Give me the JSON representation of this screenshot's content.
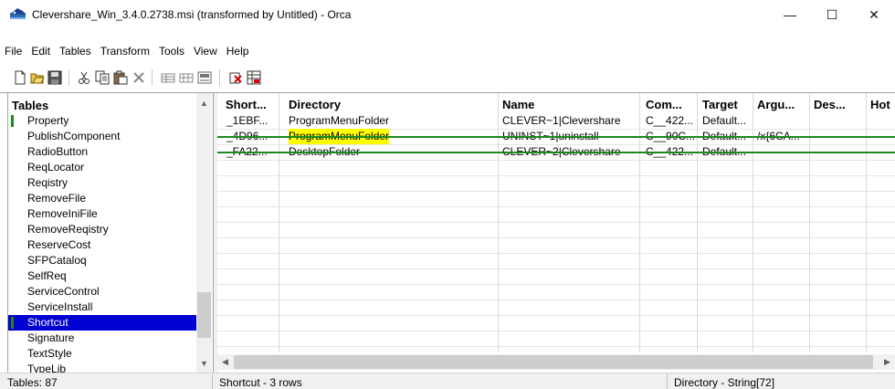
{
  "window": {
    "title": "Clevershare_Win_3.4.0.2738.msi (transformed by Untitled) - Orca",
    "minimize": "—",
    "maximize": "☐",
    "close": "✕"
  },
  "menu": [
    "File",
    "Edit",
    "Tables",
    "Transform",
    "Tools",
    "View",
    "Help"
  ],
  "toolbar_icons": [
    "new-icon",
    "open-icon",
    "save-icon",
    "cut-icon",
    "copy-icon",
    "paste-icon",
    "delete-icon",
    "add-row-icon",
    "add-table-icon",
    "drop-table-icon",
    "validate-icon",
    "merge-module-icon"
  ],
  "tables": {
    "header": "Tables",
    "items": [
      {
        "label": "Property",
        "marked": true,
        "selected": false
      },
      {
        "label": "PublishComponent",
        "marked": false,
        "selected": false
      },
      {
        "label": "RadioButton",
        "marked": false,
        "selected": false
      },
      {
        "label": "ReqLocator",
        "marked": false,
        "selected": false
      },
      {
        "label": "Reqistry",
        "marked": false,
        "selected": false
      },
      {
        "label": "RemoveFile",
        "marked": false,
        "selected": false
      },
      {
        "label": "RemoveIniFile",
        "marked": false,
        "selected": false
      },
      {
        "label": "RemoveReqistry",
        "marked": false,
        "selected": false
      },
      {
        "label": "ReserveCost",
        "marked": false,
        "selected": false
      },
      {
        "label": "SFPCataloq",
        "marked": false,
        "selected": false
      },
      {
        "label": "SelfReq",
        "marked": false,
        "selected": false
      },
      {
        "label": "ServiceControl",
        "marked": false,
        "selected": false
      },
      {
        "label": "ServiceInstall",
        "marked": false,
        "selected": false
      },
      {
        "label": "Shortcut",
        "marked": true,
        "selected": true
      },
      {
        "label": "Signature",
        "marked": false,
        "selected": false
      },
      {
        "label": "TextStyle",
        "marked": false,
        "selected": false
      },
      {
        "label": "TypeLib",
        "marked": false,
        "selected": false
      }
    ]
  },
  "grid": {
    "columns": [
      "Short...",
      "Directory",
      "Name",
      "Com...",
      "Target",
      "Argu...",
      "Des...",
      "Hot"
    ],
    "rows": [
      {
        "cells": [
          "_1EBF...",
          "ProgramMenuFolder",
          "CLEVER~1|Clevershare",
          "C__422...",
          "Default...",
          "",
          "",
          ""
        ],
        "struck": false,
        "highlight_directory": false
      },
      {
        "cells": [
          "_4D96...",
          "ProgramMenuFolder",
          "UNINST~1|uninstall",
          "C__90C...",
          "Default...",
          "/x{6CA...",
          "",
          ""
        ],
        "struck": true,
        "highlight_directory": true
      },
      {
        "cells": [
          "_FA22...",
          "DesktopFolder",
          "CLEVER~2|Clevershare",
          "C__422...",
          "Default...",
          "",
          "",
          ""
        ],
        "struck": true,
        "highlight_directory": false
      }
    ],
    "row_highlight_color": "#ffff00",
    "strike_color": "#1b8a1b"
  },
  "status": {
    "tables_count": "Tables: 87",
    "rows_info": "Shortcut - 3 rows",
    "column_info": "Directory - String[72]"
  },
  "colors": {
    "selection": "#0000d2",
    "marker": "#1b8a1b"
  }
}
